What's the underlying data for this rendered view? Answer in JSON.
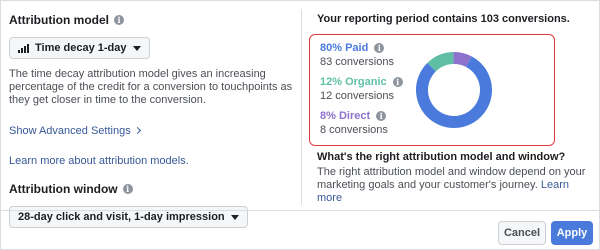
{
  "left": {
    "attribution_model": {
      "title": "Attribution model",
      "dropdown_value": "Time decay 1-day",
      "description": "The time decay attribution model gives an increasing percentage of the credit for a conversion to touchpoints as they get closer in time to the conversion.",
      "advanced_link": "Show Advanced Settings",
      "learn_link": "Learn more about attribution models."
    },
    "attribution_window": {
      "title": "Attribution window",
      "dropdown_value": "28-day click and visit, 1-day impression"
    }
  },
  "right": {
    "summary": "Your reporting period contains 103 conversions.",
    "stats": [
      {
        "percent_label": "80% Paid",
        "conversions": "83 conversions",
        "color": "#4a7bdc",
        "fraction": 0.8
      },
      {
        "percent_label": "12% Organic",
        "conversions": "12 conversions",
        "color": "#5fbfa5",
        "fraction": 0.12
      },
      {
        "percent_label": "8% Direct",
        "conversions": "8 conversions",
        "color": "#8c72cb",
        "fraction": 0.08
      }
    ],
    "question": "What's the right attribution model and window?",
    "answer": "The right attribution model and window depend on your marketing goals and your customer's journey.",
    "learn_more": "Learn more"
  },
  "footer": {
    "cancel_label": "Cancel",
    "apply_label": "Apply"
  },
  "icons": {
    "info": "info-icon",
    "bars": "signal-bars-icon",
    "caret": "caret-down-icon",
    "chevron": "chevron-right-icon"
  }
}
